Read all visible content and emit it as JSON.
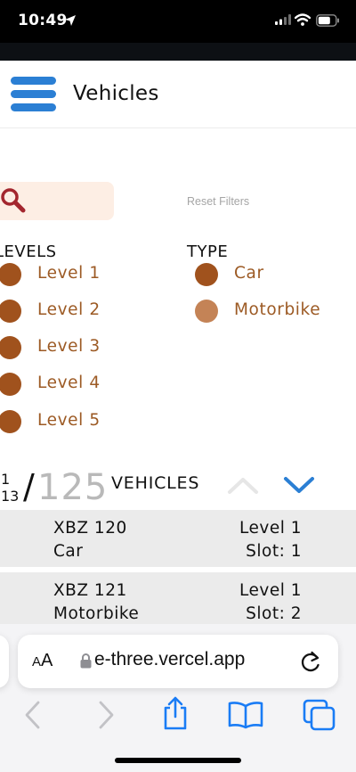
{
  "status_bar": {
    "time": "10:49"
  },
  "header": {
    "title": "Vehicles"
  },
  "filters": {
    "reset_label": "Reset Filters",
    "levels_title": "LEVELS",
    "type_title": "TYPE",
    "levels": [
      "Level 1",
      "Level 2",
      "Level 3",
      "Level 4",
      "Level 5"
    ],
    "types": [
      "Car",
      "Motorbike"
    ]
  },
  "pagination": {
    "current": "1",
    "pages": "13",
    "total": "125",
    "label": "VEHICLES"
  },
  "vehicles": [
    {
      "plate": "XBZ 120",
      "type": "Car",
      "level": "Level 1",
      "slot": "Slot: 1"
    },
    {
      "plate": "XBZ 121",
      "type": "Motorbike",
      "level": "Level 1",
      "slot": "Slot: 2"
    }
  ],
  "browser": {
    "aa_label_small": "A",
    "aa_label_large": "A",
    "url": "e-three.vercel.app"
  },
  "colors": {
    "accent_blue": "#2b7fd4",
    "dot_brown": "#a0521d",
    "dot_light_brown": "#c48356",
    "label_brown": "#9c5a24",
    "search_bg": "#fdeee4",
    "row_bg": "#ebebeb"
  }
}
